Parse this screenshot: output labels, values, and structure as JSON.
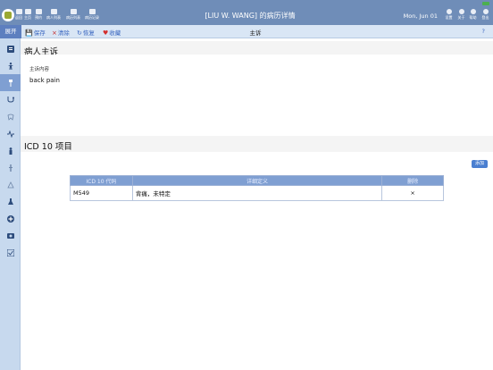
{
  "topbar": {
    "title": "[LIU W. WANG] 的病历详情",
    "date": "Mon, Jun 01",
    "nav": [
      {
        "label": "返回",
        "icon": "back-icon"
      },
      {
        "label": "主页",
        "icon": "home-icon"
      },
      {
        "label": "预约",
        "icon": "calendar-icon"
      },
      {
        "label": "病人列表",
        "icon": "patients-icon"
      },
      {
        "label": "病历列表",
        "icon": "records-icon"
      },
      {
        "label": "病历记录",
        "icon": "person-icon"
      }
    ],
    "right": [
      {
        "label": "设置",
        "icon": "gear-icon"
      },
      {
        "label": "关于",
        "icon": "list-icon"
      },
      {
        "label": "帮助",
        "icon": "info-icon"
      },
      {
        "label": "登出",
        "icon": "logout-icon"
      }
    ],
    "status_color": "#4caf50"
  },
  "toolbar": {
    "expand": "展开",
    "save": "保存",
    "clear": "清除",
    "restore": "恢复",
    "favorite": "收藏",
    "title": "主诉",
    "help": "?"
  },
  "sidebar": {
    "items": [
      {
        "icon": "chart-icon"
      },
      {
        "icon": "body-icon"
      },
      {
        "icon": "pulse-icon",
        "active": true
      },
      {
        "icon": "stethoscope-icon"
      },
      {
        "icon": "teeth-icon"
      },
      {
        "icon": "vitals-icon"
      },
      {
        "icon": "figure-icon"
      },
      {
        "icon": "injection-icon"
      },
      {
        "icon": "scale-icon"
      },
      {
        "icon": "flask-icon"
      },
      {
        "icon": "plus-icon"
      },
      {
        "icon": "image-icon"
      },
      {
        "icon": "check-icon"
      }
    ]
  },
  "complaint": {
    "heading": "病人主诉",
    "label": "主诉内容",
    "value": "back pain"
  },
  "icd": {
    "heading": "ICD 10 项目",
    "add_button": "添加",
    "columns": [
      "ICD 10 代码",
      "详细定义",
      "删除"
    ],
    "rows": [
      {
        "code": "M549",
        "definition": "背痛，未特定",
        "delete": "×"
      }
    ]
  },
  "colors": {
    "topbar": "#6f8db8",
    "accent": "#4a7fd1",
    "sidebar": "#c7d9ee",
    "delete": "#c62828"
  }
}
